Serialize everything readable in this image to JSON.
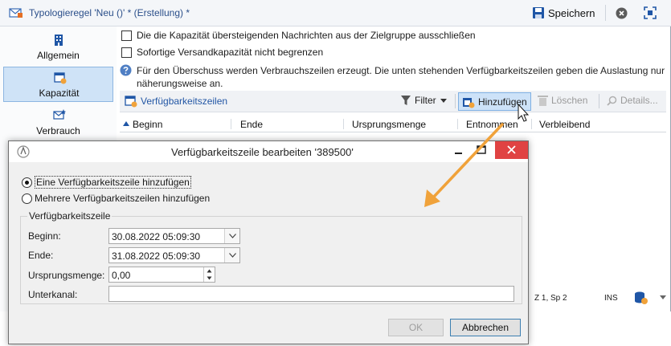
{
  "window": {
    "title": "Typologieregel 'Neu ()' * (Erstellung) *",
    "save_label": "Speichern"
  },
  "sidebar": {
    "items": [
      {
        "label": "Allgemein",
        "icon": "building-icon"
      },
      {
        "label": "Kapazität",
        "icon": "calendar-clock-icon",
        "selected": true
      },
      {
        "label": "Verbrauch",
        "icon": "envelope-star-icon"
      }
    ]
  },
  "content": {
    "check_exclude": "Die die Kapazität übersteigenden Nachrichten aus der Zielgruppe ausschließen",
    "check_unlimited": "Sofortige Versandkapazität nicht begrenzen",
    "info_text": "Für den Überschuss werden Verbrauchszeilen erzeugt. Die unten stehenden Verfügbarkeitszeilen geben die Auslastung nur näherungsweise an."
  },
  "list": {
    "title": "Verfügbarkeitszeilen",
    "filter_label": "Filter",
    "add_label": "Hinzufügen",
    "delete_label": "Löschen",
    "details_label": "Details...",
    "columns": [
      "Beginn",
      "Ende",
      "Ursprungsmenge",
      "Entnommen",
      "Verbleibend"
    ]
  },
  "status": {
    "position": "Z 1, Sp 2",
    "mode": "INS"
  },
  "dialog": {
    "title": "Verfügbarkeitszeile bearbeiten '389500'",
    "radio_single": "Eine Verfügbarkeitszeile hinzufügen",
    "radio_multiple": "Mehrere Verfügbarkeitszeilen hinzufügen",
    "group_title": "Verfügbarkeitszeile",
    "begin_label": "Beginn:",
    "begin_value": "30.08.2022 05:09:30",
    "end_label": "Ende:",
    "end_value": "31.08.2022 05:09:30",
    "quantity_label": "Ursprungsmenge:",
    "quantity_value": "0,00",
    "subchannel_label": "Unterkanal:",
    "subchannel_value": "",
    "ok_label": "OK",
    "cancel_label": "Abbrechen"
  },
  "colors": {
    "accent": "#2357a5",
    "selection": "#cfe3f7",
    "close_red": "#e04343",
    "arrow_orange": "#f0a23a"
  }
}
